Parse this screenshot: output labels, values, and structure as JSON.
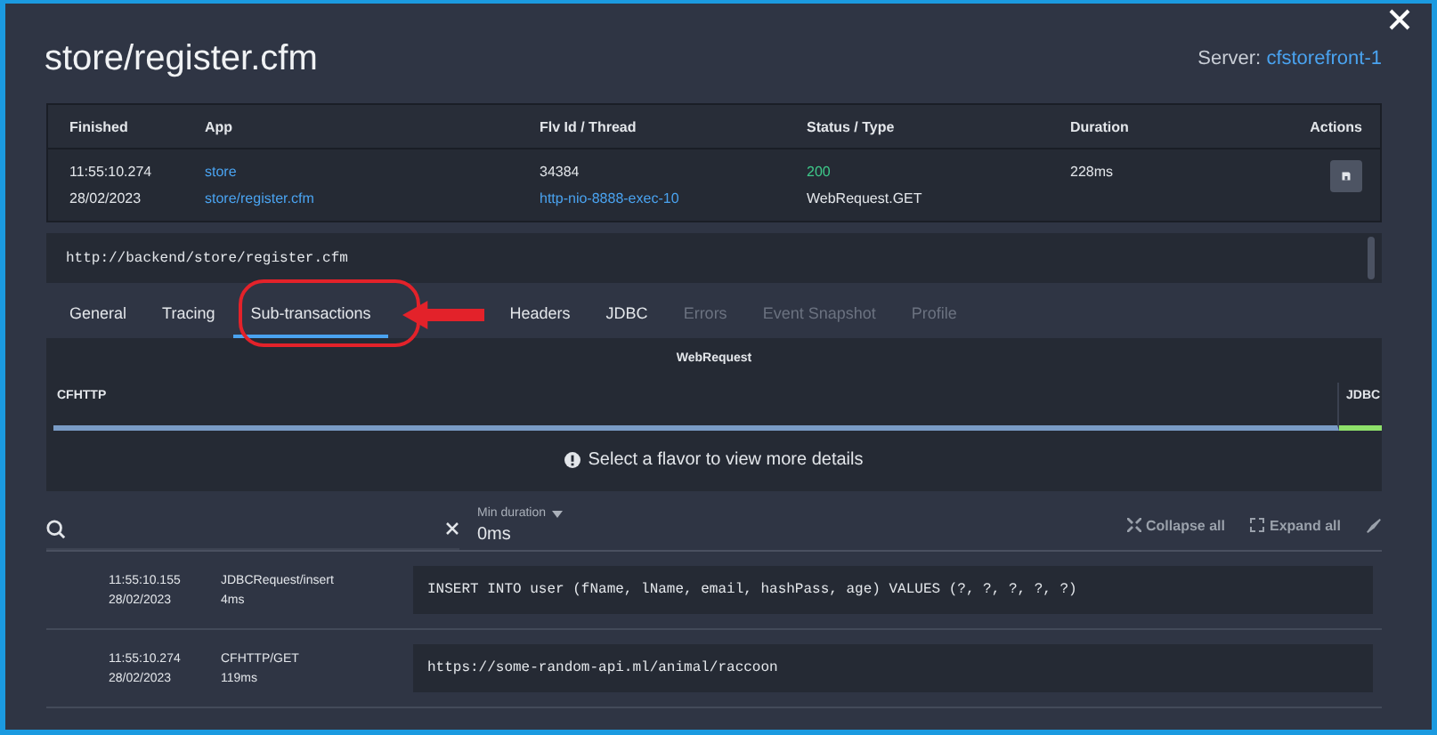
{
  "title": "store/register.cfm",
  "server": {
    "label": "Server:",
    "value": "cfstorefront-1"
  },
  "summary": {
    "columns": [
      "Finished",
      "App",
      "Flv Id / Thread",
      "Status / Type",
      "Duration",
      "Actions"
    ],
    "time": "11:55:10.274",
    "date": "28/02/2023",
    "app": "store",
    "app_path": "store/register.cfm",
    "flv_id": "34384",
    "thread": "http-nio-8888-exec-10",
    "status": "200",
    "type": "WebRequest.GET",
    "duration": "228ms"
  },
  "url": "http://backend/store/register.cfm",
  "tabs": [
    {
      "label": "General",
      "selected": false,
      "disabled": false
    },
    {
      "label": "Tracing",
      "selected": false,
      "disabled": false
    },
    {
      "label": "Sub-transactions",
      "selected": true,
      "disabled": false
    },
    {
      "label": "Headers",
      "selected": false,
      "disabled": false
    },
    {
      "label": "JDBC",
      "selected": false,
      "disabled": false
    },
    {
      "label": "Errors",
      "selected": false,
      "disabled": true
    },
    {
      "label": "Event Snapshot",
      "selected": false,
      "disabled": true
    },
    {
      "label": "Profile",
      "selected": false,
      "disabled": true
    }
  ],
  "flavors": {
    "title": "WebRequest",
    "segments": [
      {
        "label": "CFHTTP",
        "color": "#7a9cc6"
      },
      {
        "label": "JDBC",
        "color": "#8ee06a"
      }
    ],
    "hint": "Select a flavor to view more details"
  },
  "filter": {
    "min_label": "Min duration",
    "min_value": "0ms",
    "collapse": "Collapse all",
    "expand": "Expand all"
  },
  "rows": [
    {
      "time": "11:55:10.155",
      "date": "28/02/2023",
      "name": "JDBCRequest/insert",
      "duration": "4ms",
      "detail": "INSERT INTO user (fName, lName, email, hashPass, age) VALUES (?, ?, ?, ?, ?)"
    },
    {
      "time": "11:55:10.274",
      "date": "28/02/2023",
      "name": "CFHTTP/GET",
      "duration": "119ms",
      "detail": "https://some-random-api.ml/animal/raccoon"
    }
  ]
}
